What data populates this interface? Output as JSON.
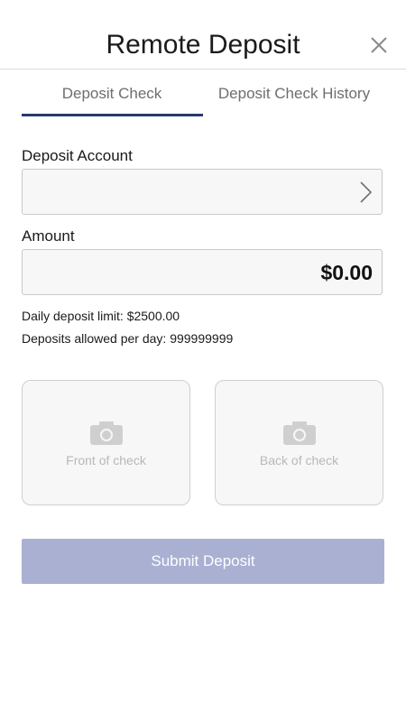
{
  "header": {
    "title": "Remote Deposit",
    "close_icon": "close-icon"
  },
  "tabs": [
    {
      "label": "Deposit Check",
      "active": true
    },
    {
      "label": "Deposit Check History",
      "active": false
    }
  ],
  "form": {
    "account_label": "Deposit Account",
    "account_value": "",
    "amount_label": "Amount",
    "amount_value": "$0.00"
  },
  "info": {
    "daily_limit": "Daily deposit limit: $2500.00",
    "deposits_allowed": "Deposits allowed per day: 999999999"
  },
  "check_images": {
    "front_label": "Front of check",
    "back_label": "Back of check",
    "icon": "camera-icon"
  },
  "submit": {
    "label": "Submit Deposit",
    "enabled": false
  },
  "colors": {
    "tab_accent": "#263b6b",
    "submit_disabled": "#a9b0d2",
    "field_bg": "#f7f7f8",
    "placeholder_text": "#b8b8b8"
  }
}
